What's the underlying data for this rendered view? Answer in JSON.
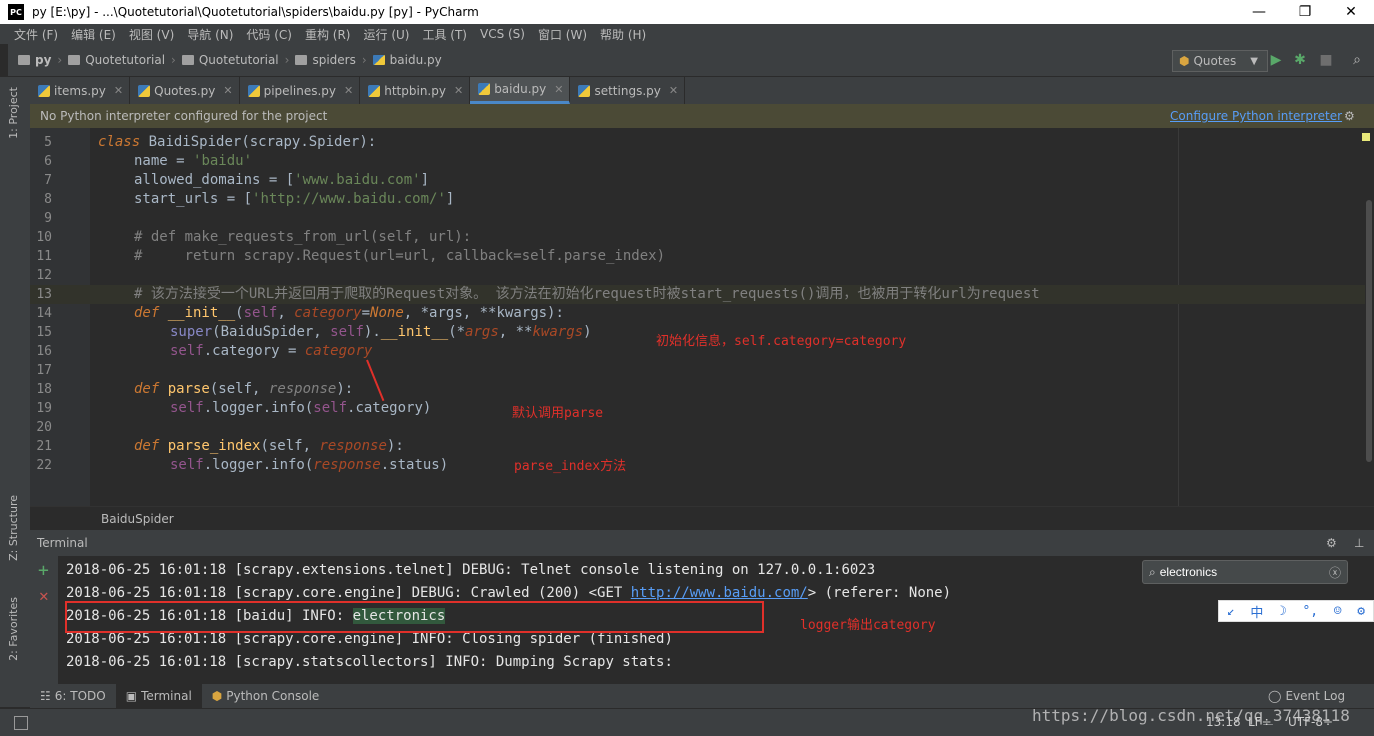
{
  "window": {
    "app_icon": "PC",
    "title": "py [E:\\py] - ...\\Quotetutorial\\Quotetutorial\\spiders\\baidu.py [py] - PyCharm",
    "minimize": "—",
    "maximize": "❐",
    "close": "✕"
  },
  "menu": [
    "文件 (F)",
    "编辑 (E)",
    "视图 (V)",
    "导航 (N)",
    "代码 (C)",
    "重构 (R)",
    "运行 (U)",
    "工具 (T)",
    "VCS (S)",
    "窗口 (W)",
    "帮助 (H)"
  ],
  "breadcrumbs": [
    "py",
    "Quotetutorial",
    "Quotetutorial",
    "spiders",
    "baidu.py"
  ],
  "run_config": "Quotes",
  "tabs": [
    {
      "label": "items.py",
      "active": false
    },
    {
      "label": "Quotes.py",
      "active": false
    },
    {
      "label": "pipelines.py",
      "active": false
    },
    {
      "label": "httpbin.py",
      "active": false
    },
    {
      "label": "baidu.py",
      "active": true
    },
    {
      "label": "settings.py",
      "active": false
    }
  ],
  "left_tools": {
    "project": "1: Project",
    "structure": "Z: Structure",
    "favorites": "2: Favorites"
  },
  "notice": {
    "text": "No Python interpreter configured for the project",
    "link": "Configure Python interpreter"
  },
  "code": {
    "line_numbers": [
      "5",
      "6",
      "7",
      "8",
      "9",
      "10",
      "11",
      "12",
      "13",
      "14",
      "15",
      "16",
      "17",
      "18",
      "19",
      "20",
      "21",
      "22"
    ],
    "l5": {
      "kw": "class",
      "cls": "BaidiSpider",
      "rest": "(scrapy.Spider):"
    },
    "l6": {
      "name": "name = ",
      "val": "'baidu'"
    },
    "l7": {
      "name": "allowed_domains = [",
      "val": "'www.baidu.com'",
      "end": "]"
    },
    "l8": {
      "name": "start_urls = [",
      "val": "'http://www.baidu.com/'",
      "end": "]"
    },
    "l10": "# def make_requests_from_url(self, url):",
    "l11": "#     return scrapy.Request(url=url, callback=self.parse_index)",
    "l13": "# 该方法接受一个URL并返回用于爬取的Request对象。 该方法在初始化request时被start_requests()调用，也被用于转化url为request",
    "l14": {
      "kw": "def ",
      "fn": "__init__",
      "a": "(",
      "self": "self",
      "b": ", ",
      "p1": "category",
      "c": "=",
      "none": "None",
      "d": ", *args, **kwargs):"
    },
    "l15": {
      "bi": "super",
      "a": "(BaiduSpider, ",
      "self": "self",
      "b": ").",
      "fn": "__init__",
      "c": "(*",
      "p1": "args",
      "d": ", **",
      "p2": "kwargs",
      "e": ")"
    },
    "l16": {
      "self": "self",
      "a": ".category = ",
      "p": "category"
    },
    "l18": {
      "kw": "def ",
      "fn": "parse",
      "a": "(self, ",
      "p": "response",
      "b": "):"
    },
    "l19": {
      "self": "self",
      "a": ".logger.info(",
      "self2": "self",
      "b": ".category)"
    },
    "l21": {
      "kw": "def ",
      "fn": "parse_index",
      "a": "(self, ",
      "p": "response",
      "b": "):"
    },
    "l22": {
      "self": "self",
      "a": ".logger.info(",
      "p": "response",
      "b": ".status)"
    }
  },
  "annotations": {
    "init": "初始化信息，self.category=category",
    "parse": "默认调用parse",
    "parse_index": "parse_index方法",
    "logger": "logger输出category"
  },
  "structure_crumb": "BaiduSpider",
  "terminal": {
    "title": "Terminal",
    "search_value": "electronics",
    "lines": [
      "2018-06-25 16:01:18 [scrapy.extensions.telnet] DEBUG: Telnet console listening on 127.0.0.1:6023",
      "2018-06-25 16:01:18 [scrapy.core.engine] DEBUG: Crawled (200) <GET ",
      "2018-06-25 16:01:18 [baidu] INFO: ",
      "2018-06-25 16:01:18 [scrapy.core.engine] INFO: Closing spider (finished)",
      "2018-06-25 16:01:18 [scrapy.statscollectors] INFO: Dumping Scrapy stats:"
    ],
    "crawl_url": "http://www.baidu.com/",
    "crawl_tail": "> (referer: None)",
    "match": "electronics"
  },
  "ime": [
    "↙",
    "中",
    "☽",
    "°,",
    "☺",
    "⚙"
  ],
  "bottom_tabs": [
    {
      "label": "6: TODO",
      "active": false
    },
    {
      "label": "Terminal",
      "active": true
    },
    {
      "label": "Python Console",
      "active": false
    }
  ],
  "event_log": "Event Log",
  "status": {
    "pos": "13:18",
    "sep": "LF÷",
    "enc": "UTF-8÷",
    "watermark": "https://blog.csdn.net/qq_37438118"
  },
  "colors": {
    "accent": "#4a88c7",
    "annotation": "#e0302a",
    "link": "#589df6"
  }
}
